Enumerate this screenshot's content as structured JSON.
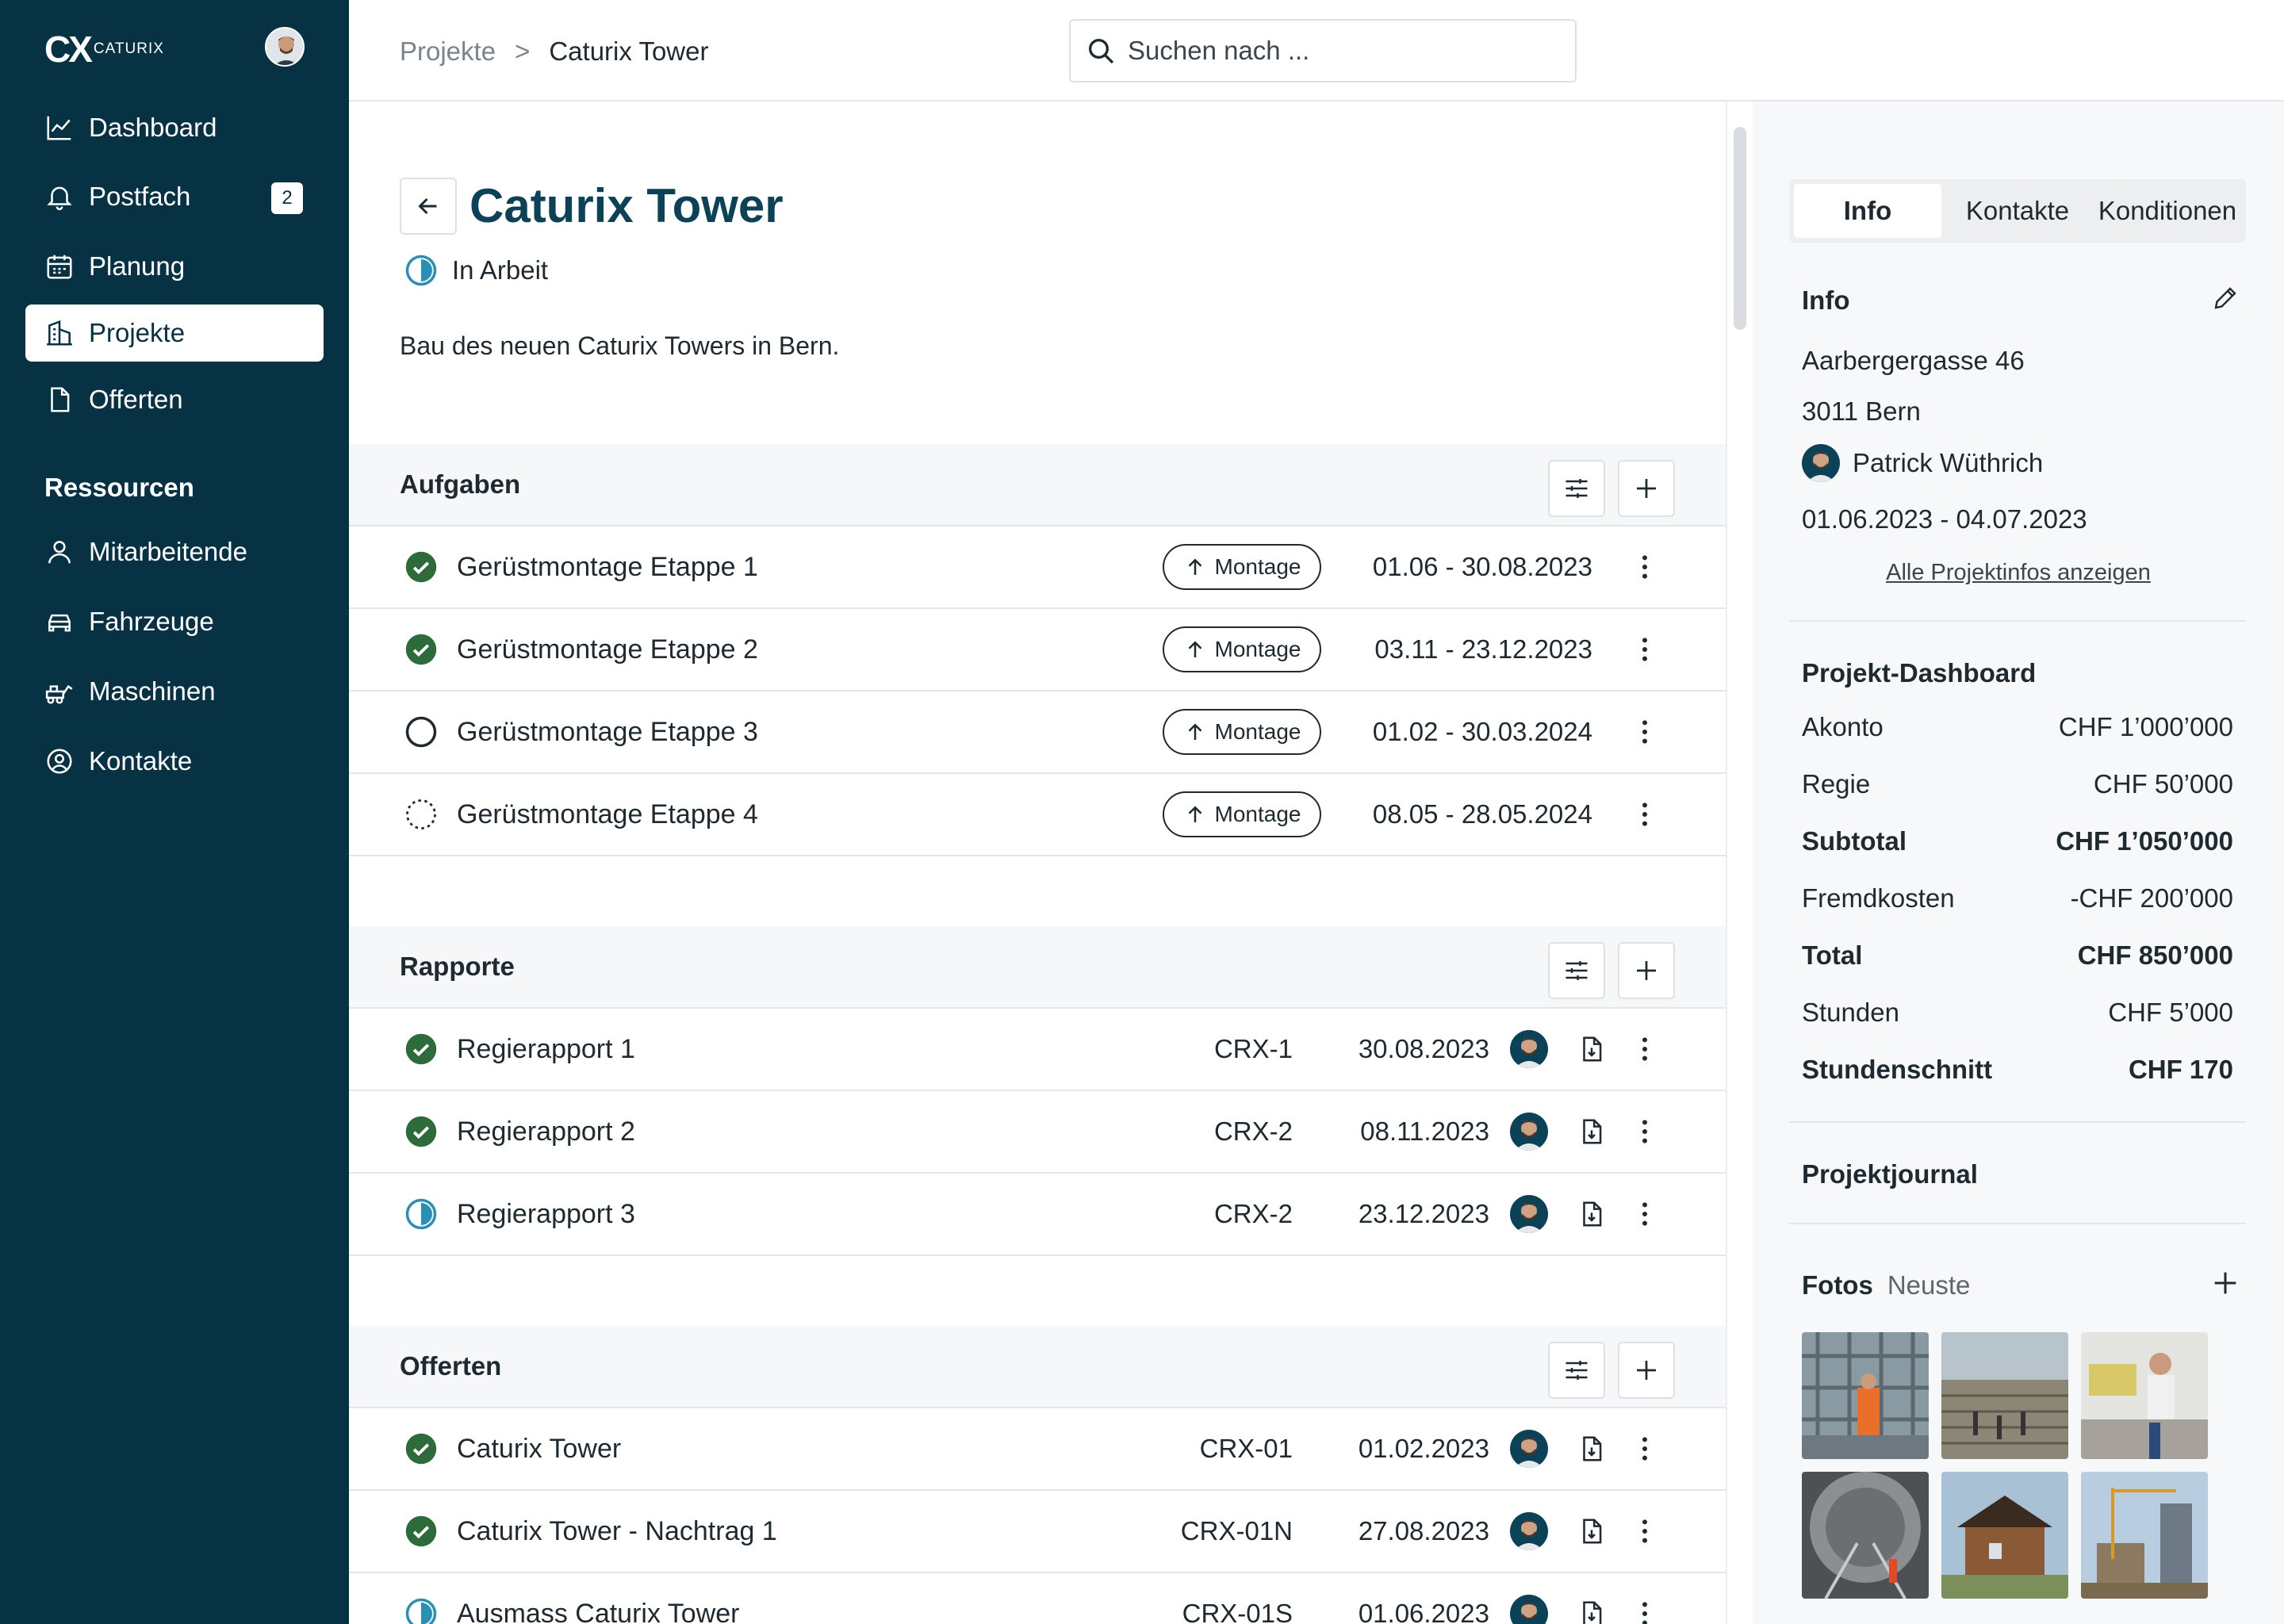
{
  "app": {
    "logo_mark": "CX",
    "logo_name": "CATURIX"
  },
  "sidebar": {
    "items": [
      {
        "label": "Dashboard",
        "icon": "chart-line-icon"
      },
      {
        "label": "Postfach",
        "icon": "bell-icon",
        "badge": "2"
      },
      {
        "label": "Planung",
        "icon": "calendar-icon"
      },
      {
        "label": "Projekte",
        "icon": "building-icon",
        "active": true
      },
      {
        "label": "Offerten",
        "icon": "document-icon"
      }
    ],
    "resources_title": "Ressourcen",
    "resources": [
      {
        "label": "Mitarbeitende",
        "icon": "person-icon"
      },
      {
        "label": "Fahrzeuge",
        "icon": "car-icon"
      },
      {
        "label": "Maschinen",
        "icon": "machine-icon"
      },
      {
        "label": "Kontakte",
        "icon": "contact-circle-icon"
      }
    ]
  },
  "topbar": {
    "breadcrumb": {
      "root": "Projekte",
      "separator": ">",
      "current": "Caturix Tower"
    },
    "search": {
      "placeholder": "Suchen nach ...",
      "value": ""
    }
  },
  "project": {
    "title": "Caturix Tower",
    "status": "In Arbeit",
    "description": "Bau des neuen Caturix Towers in Bern."
  },
  "tasks": {
    "title": "Aufgaben",
    "rows": [
      {
        "title": "Gerüstmontage Etappe 1",
        "tag": "Montage",
        "dates": "01.06 - 30.08.2023",
        "status": "done"
      },
      {
        "title": "Gerüstmontage Etappe 2",
        "tag": "Montage",
        "dates": "03.11 - 23.12.2023",
        "status": "done"
      },
      {
        "title": "Gerüstmontage Etappe 3",
        "tag": "Montage",
        "dates": "01.02 - 30.03.2024",
        "status": "open"
      },
      {
        "title": "Gerüstmontage Etappe 4",
        "tag": "Montage",
        "dates": "08.05 - 28.05.2024",
        "status": "planned"
      }
    ]
  },
  "reports": {
    "title": "Rapporte",
    "rows": [
      {
        "title": "Regierapport 1",
        "code": "CRX-1",
        "date": "30.08.2023",
        "status": "done"
      },
      {
        "title": "Regierapport 2",
        "code": "CRX-2",
        "date": "08.11.2023",
        "status": "done"
      },
      {
        "title": "Regierapport 3",
        "code": "CRX-2",
        "date": "23.12.2023",
        "status": "in-progress"
      }
    ]
  },
  "offers": {
    "title": "Offerten",
    "rows": [
      {
        "title": "Caturix Tower",
        "code": "CRX-01",
        "date": "01.02.2023",
        "status": "done"
      },
      {
        "title": "Caturix Tower - Nachtrag 1",
        "code": "CRX-01N",
        "date": "27.08.2023",
        "status": "done"
      },
      {
        "title": "Ausmass Caturix Tower",
        "code": "CRX-01S",
        "date": "01.06.2023",
        "status": "in-progress"
      }
    ]
  },
  "panel": {
    "tabs": [
      "Info",
      "Kontakte",
      "Konditionen"
    ],
    "active_tab": "Info",
    "info": {
      "title": "Info",
      "street": "Aarbergergasse 46",
      "city": "3011 Bern",
      "contact": "Patrick Wüthrich",
      "period": "01.06.2023 - 04.07.2023",
      "all_link": "Alle Projektinfos anzeigen"
    },
    "dashboard": {
      "title": "Projekt-Dashboard",
      "rows": [
        {
          "label": "Akonto",
          "value": "CHF 1’000’000",
          "bold": false
        },
        {
          "label": "Regie",
          "value": "CHF 50’000",
          "bold": false
        },
        {
          "label": "Subtotal",
          "value": "CHF 1’050’000",
          "bold": true
        },
        {
          "label": "Fremdkosten",
          "value": "-CHF 200’000",
          "bold": false
        },
        {
          "label": "Total",
          "value": "CHF 850’000",
          "bold": true
        },
        {
          "label": "Stunden",
          "value": "CHF 5’000",
          "bold": false
        },
        {
          "label": "Stundenschnitt",
          "value": "CHF 170",
          "bold": true
        }
      ]
    },
    "journal_title": "Projektjournal",
    "photos": {
      "title": "Fotos",
      "subtitle": "Neuste"
    }
  },
  "colors": {
    "sidebar": "#063244",
    "accent": "#0b4258",
    "done": "#2e6b3a",
    "progress": "#2a8fb5"
  }
}
